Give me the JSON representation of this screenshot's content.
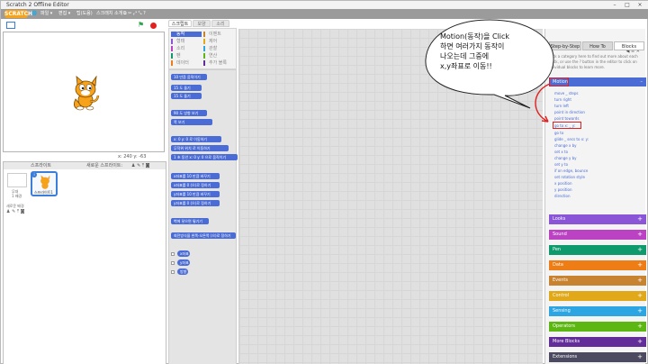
{
  "window": {
    "title": "Scratch 2 Offline Editor",
    "controls": [
      "–",
      "□",
      "×"
    ]
  },
  "menubar": {
    "logo": "SCRATCH",
    "items": [
      "파일 ▾",
      "편집 ▾",
      "팁(도움)",
      "스크래치 소개"
    ]
  },
  "stage": {
    "coords": "x: 240  y: -63"
  },
  "palette_tabs": [
    "스크립트",
    "모양",
    "소리"
  ],
  "categories": {
    "left": [
      "동작",
      "형태",
      "소리",
      "펜",
      "데이터"
    ],
    "right": [
      "이벤트",
      "제어",
      "관찰",
      "연산",
      "추가 블록"
    ],
    "colors": {
      "motion": "#4a6cd4",
      "looks": "#8a55d7",
      "sound": "#bb42c3",
      "pen": "#0e9a6c",
      "data": "#ee7d16",
      "events": "#c88330",
      "control": "#e1a91a",
      "sensing": "#2ca5e2",
      "operators": "#5cb712",
      "more": "#632d99"
    }
  },
  "blocks": [
    "10 만큼 움직이기",
    "15 도 돌기",
    "15 도 돌기",
    "90 도 방향 보기",
    "쪽 보기",
    "x: 0 y: 0 로 이동하기",
    "무작위 위치 로 이동하기",
    "1 초 동안 x: 0 y: 0 으로 움직이기",
    "x좌표를 10 만큼 바꾸기",
    "x좌표를 0 (으)로 정하기",
    "y좌표를 10 만큼 바꾸기",
    "y좌표를 0 (으)로 정하기",
    "벽에 닿으면 튕기기",
    "회전방식을 왼쪽-오른쪽 (으)로 정하기",
    "x좌표",
    "y좌표",
    "방향"
  ],
  "sprites_panel": {
    "title": "스프라이트",
    "new_sprite": "새로운 스프라이트:",
    "stage_label": "무대",
    "backdrops": "1 배경",
    "new_backdrop": "새로운 배경",
    "sprite_name": "스프라이트1"
  },
  "tips": {
    "tabs": [
      "Step-by-Step",
      "How To",
      "Blocks"
    ],
    "intro": "Click a category here to find out more about each block, or use the ? button in the editor to click on individual blocks to learn more.",
    "motion": "Motion",
    "motion_items": [
      "move _ steps",
      "turn right",
      "turn left",
      "point in direction",
      "point towards",
      "go to x: _ y:",
      "go to",
      "glide _ secs to x: y:",
      "change x by",
      "set x to",
      "change y by",
      "set y to",
      "if on edge, bounce",
      "set rotation style",
      "x position",
      "y position",
      "direction"
    ],
    "categories": [
      "Looks",
      "Sound",
      "Pen",
      "Data",
      "Events",
      "Control",
      "Sensing",
      "Operators",
      "More Blocks",
      "Extensions"
    ]
  },
  "callout": {
    "lines": [
      "Motion(동작)을 Click",
      "하면 여러가지 동작이",
      "나오는데 그중에",
      "x,y좌표로 이동!!"
    ]
  }
}
